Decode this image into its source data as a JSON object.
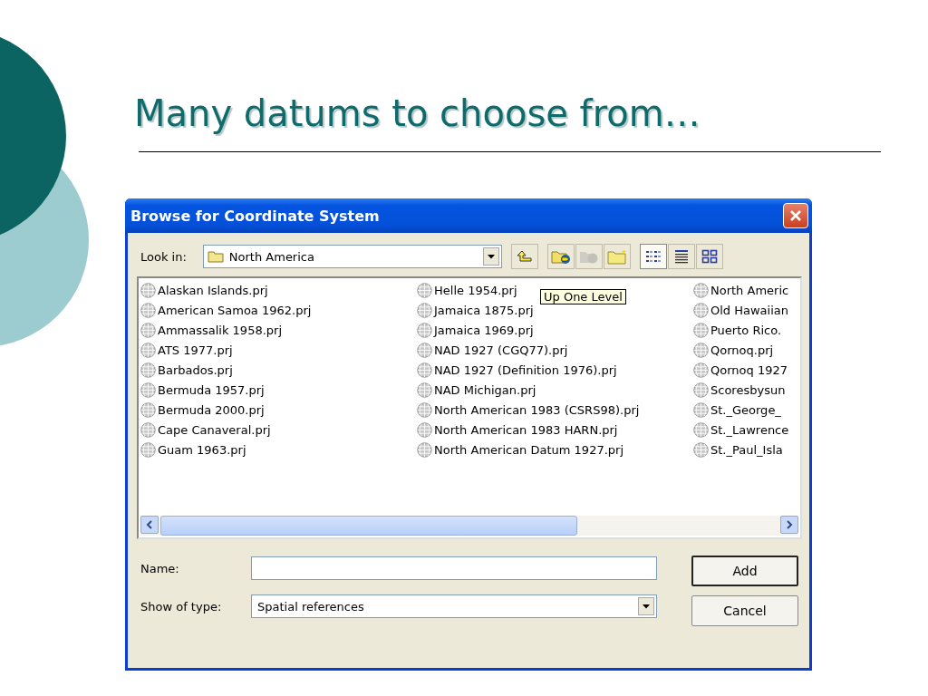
{
  "slide": {
    "title": "Many datums to choose from…"
  },
  "dialog": {
    "title": "Browse for Coordinate System",
    "look_in": {
      "label": "Look in:",
      "value": "North America"
    },
    "toolbar": [
      [
        {
          "kind": "up",
          "disabled": false,
          "selected": false
        }
      ],
      [
        {
          "kind": "connect",
          "disabled": false,
          "selected": false
        },
        {
          "kind": "disconnect",
          "disabled": true,
          "selected": false
        },
        {
          "kind": "newfolder",
          "disabled": false,
          "selected": false
        }
      ],
      [
        {
          "kind": "list",
          "disabled": false,
          "selected": true
        },
        {
          "kind": "details",
          "disabled": false,
          "selected": false
        },
        {
          "kind": "thumbnails",
          "disabled": false,
          "selected": false
        }
      ]
    ],
    "tooltip": "Up One Level",
    "file_columns": [
      [
        "Alaskan Islands.prj",
        "American Samoa 1962.prj",
        "Ammassalik 1958.prj",
        "ATS 1977.prj",
        "Barbados.prj",
        "Bermuda 1957.prj",
        "Bermuda 2000.prj",
        "Cape Canaveral.prj",
        "Guam 1963.prj"
      ],
      [
        "Helle 1954.prj",
        "Jamaica 1875.prj",
        "Jamaica 1969.prj",
        "NAD 1927 (CGQ77).prj",
        "NAD 1927 (Definition 1976).prj",
        "NAD Michigan.prj",
        "North American 1983 (CSRS98).prj",
        "North American 1983 HARN.prj",
        "North American Datum 1927.prj"
      ],
      [
        "North Americ",
        "Old Hawaiian",
        "Puerto Rico.",
        "Qornoq.prj",
        "Qornoq 1927",
        "Scoresbysun",
        "St._George_",
        "St._Lawrence",
        "St._Paul_Isla"
      ]
    ],
    "name": {
      "label": "Name:"
    },
    "type": {
      "label": "Show of type:",
      "value": "Spatial references"
    },
    "buttons": [
      {
        "label": "Add",
        "default": true
      },
      {
        "label": "Cancel",
        "default": false
      }
    ]
  }
}
